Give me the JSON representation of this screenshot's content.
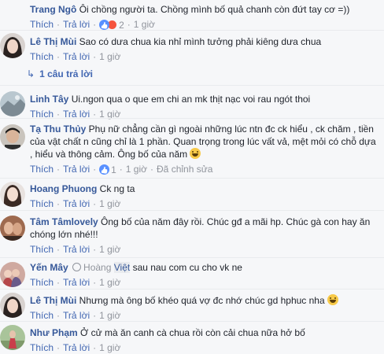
{
  "comments": [
    {
      "name": "Trang Ngô",
      "text": "Ôi chồng người ta. Chồng mình bố quả chanh còn đứt tay cơ =))",
      "like_label": "Thích",
      "reply_label": "Trả lời",
      "reaction_count": "2",
      "time": "1 giờ"
    },
    {
      "name": "Lê Thị Mùi",
      "text": "Sao có dưa chua kia nhỉ mình tưởng phải kiêng dưa chua",
      "like_label": "Thích",
      "reply_label": "Trả lời",
      "time": "1 giờ",
      "replies_label": "1 câu trả lời"
    },
    {
      "name": "Linh Tây",
      "text": "Ui.ngon qua o que em chi an mk thịt nạc voi rau ngót thoi",
      "like_label": "Thích",
      "reply_label": "Trả lời",
      "time": "1 giờ"
    },
    {
      "name": "Tạ Thu Thủy",
      "text": "Phụ nữ chẳng cần gì ngoài những lúc ntn đc ck hiểu , ck chăm , tiền của vật chất n cũng chỉ là 1 phần. Quan trọng trong lúc vất vả, mệt mỏi có chỗ dựa , hiểu và thông cảm. Ông bố của năm",
      "like_label": "Thích",
      "reply_label": "Trả lời",
      "reaction_count": "1",
      "time": "1 giờ",
      "edited_label": "Đã chỉnh sửa"
    },
    {
      "name": "Hoang Phuong",
      "text": "Ck ng ta",
      "like_label": "Thích",
      "reply_label": "Trả lời",
      "time": "1 giờ"
    },
    {
      "name": "Tâm Tâmlovely",
      "text": "Ông bố của năm đây rồi. Chúc gđ a mãi hp. Chúc gà con hay ăn chóng lớn nhé!!!",
      "like_label": "Thích",
      "reply_label": "Trả lời",
      "time": "1 giờ"
    },
    {
      "name": "Yến Mây",
      "tag_prefix": "Hoàng",
      "tag_highlight": "Việt",
      "text": "sau nau com cu cho vk ne",
      "like_label": "Thích",
      "reply_label": "Trả lời",
      "time": "1 giờ"
    },
    {
      "name": "Lê Thị Mùi",
      "text": "Nhưng mà ông bố khéo quá vợ đc nhớ chúc gd hphuc nha",
      "like_label": "Thích",
      "reply_label": "Trả lời",
      "time": "1 giờ"
    },
    {
      "name": "Như Phạm",
      "text": "Ở cử mà ăn canh cà chua rồi còn cải chua nữa hở bố",
      "like_label": "Thích",
      "reply_label": "Trả lời",
      "time": "1 giờ"
    }
  ],
  "colors": {
    "name": "#365899",
    "link": "#4267b2",
    "meta": "#90949c",
    "background": "#f6f7f9"
  }
}
